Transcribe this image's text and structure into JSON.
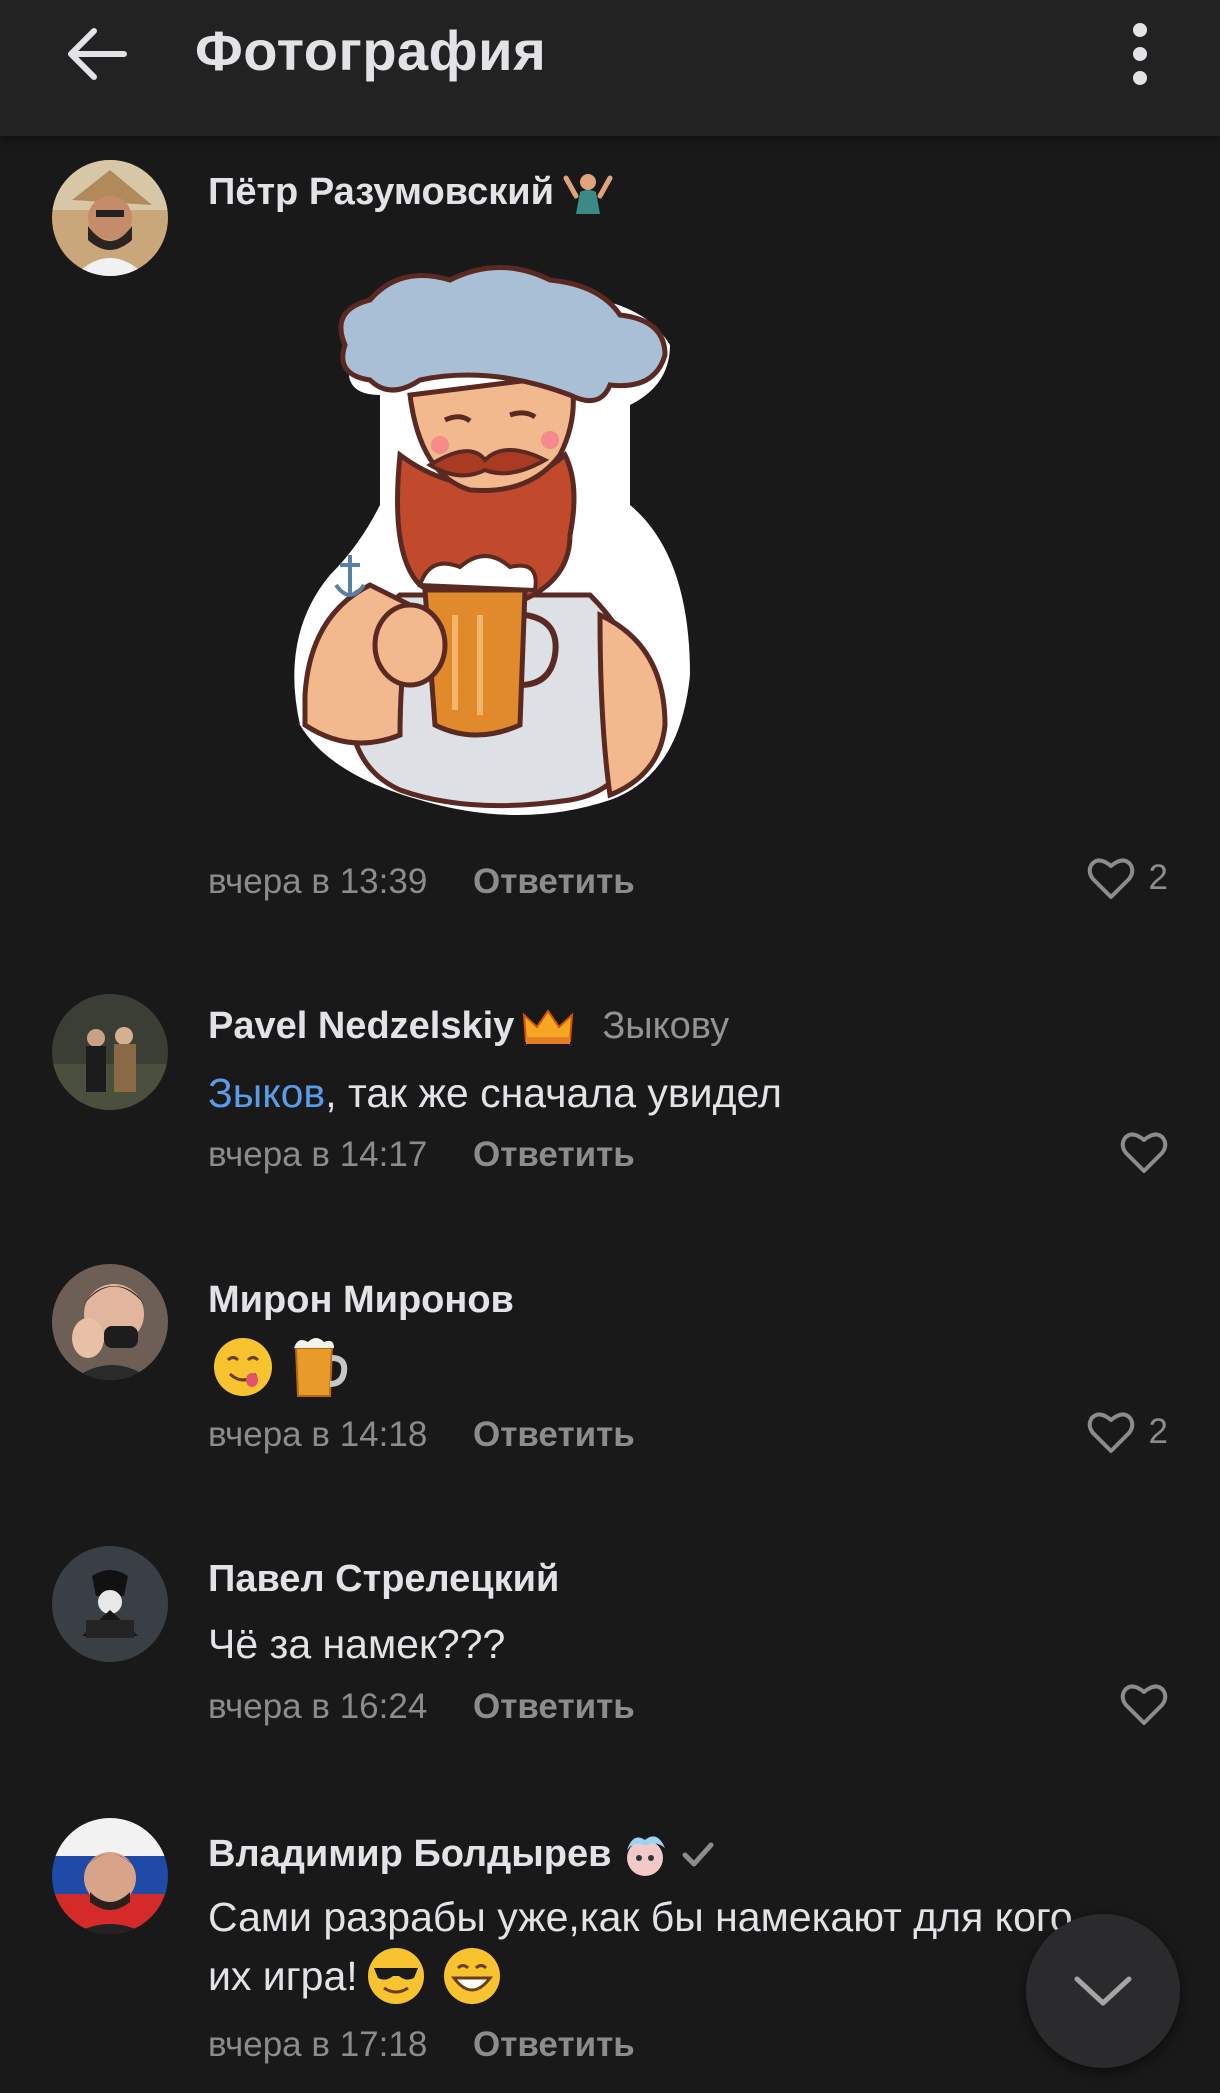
{
  "appbar": {
    "title": "Фотография"
  },
  "comments": [
    {
      "author": "Пётр Разумовский",
      "time": "вчера в 13:39",
      "reply_label": "Ответить",
      "likes": "2"
    },
    {
      "author": "Pavel Nedzelskiy",
      "reply_to": "Зыкову",
      "mention": "Зыков",
      "text_rest": ", так же сначала увидел",
      "time": "вчера в 14:17",
      "reply_label": "Ответить"
    },
    {
      "author": "Мирон Миронов",
      "time": "вчера в 14:18",
      "reply_label": "Ответить",
      "likes": "2"
    },
    {
      "author": "Павел Стрелецкий",
      "text": "Чё за намек???",
      "time": "вчера в 16:24",
      "reply_label": "Ответить"
    },
    {
      "author": "Владимир Болдырев",
      "text_line1": "Сами разрабы уже,как бы намекают для кого",
      "text_line2": "их игра!",
      "time": "вчера в 17:18",
      "reply_label": "Ответить"
    }
  ],
  "colors": {
    "background": "#19191a",
    "appbar": "#222222",
    "link": "#5a9bea",
    "secondary": "#8c8c8c"
  },
  "icons": [
    "back-arrow-icon",
    "more-vertical-icon",
    "heart-icon",
    "chevron-down-icon",
    "verified-check-icon"
  ]
}
